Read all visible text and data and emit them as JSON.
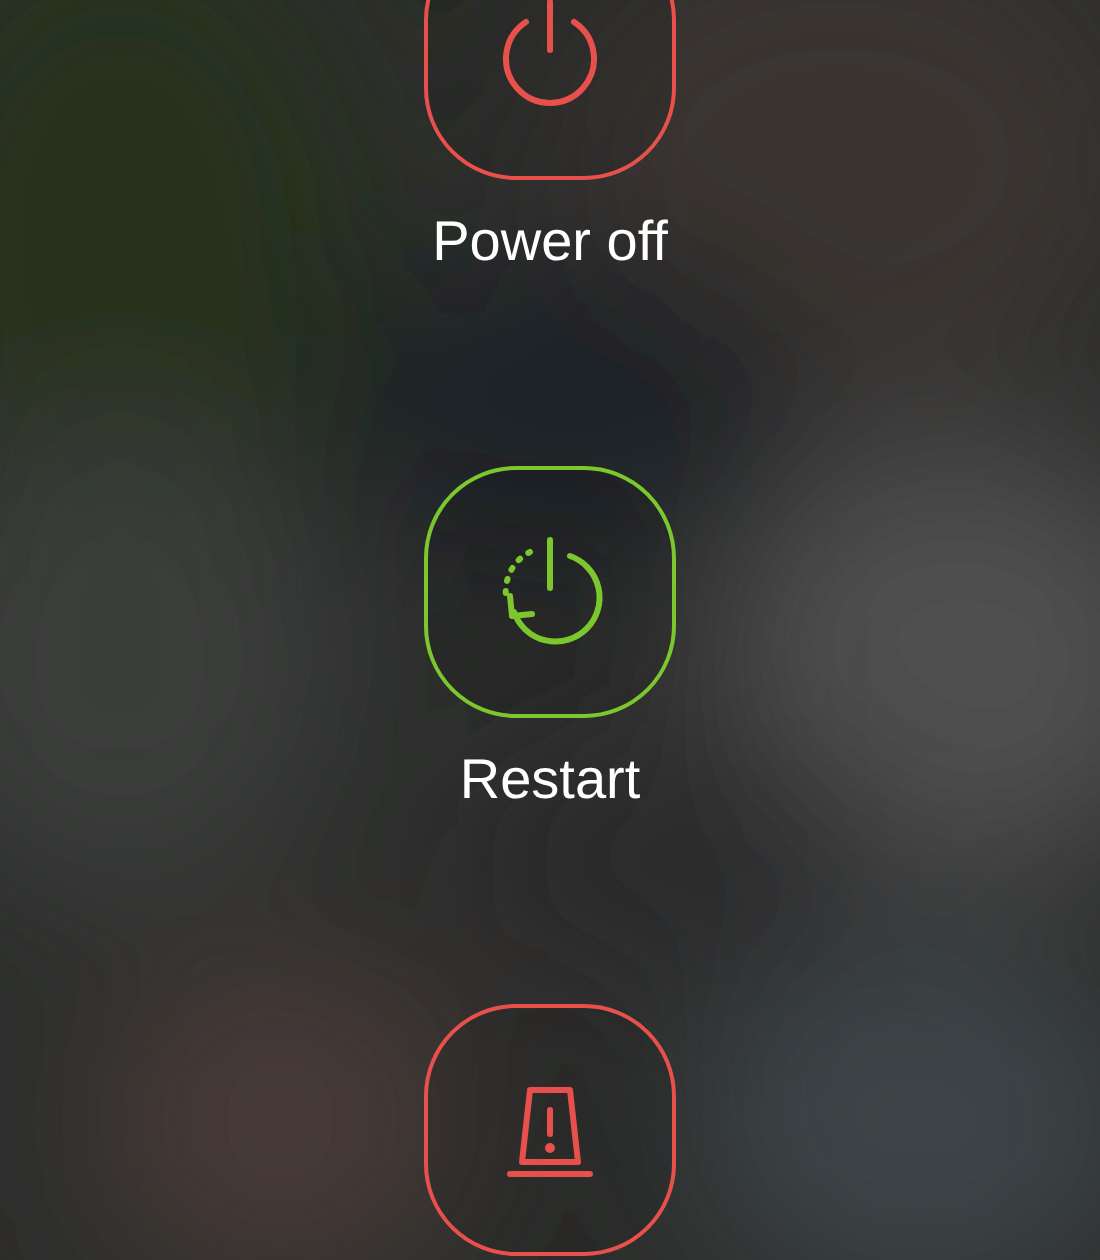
{
  "actions": [
    {
      "kind": "power",
      "label": "Power off",
      "color": "#e8504c"
    },
    {
      "kind": "restart",
      "label": "Restart",
      "color": "#7cc62e"
    },
    {
      "kind": "emergency",
      "color": "#e8504c"
    }
  ]
}
